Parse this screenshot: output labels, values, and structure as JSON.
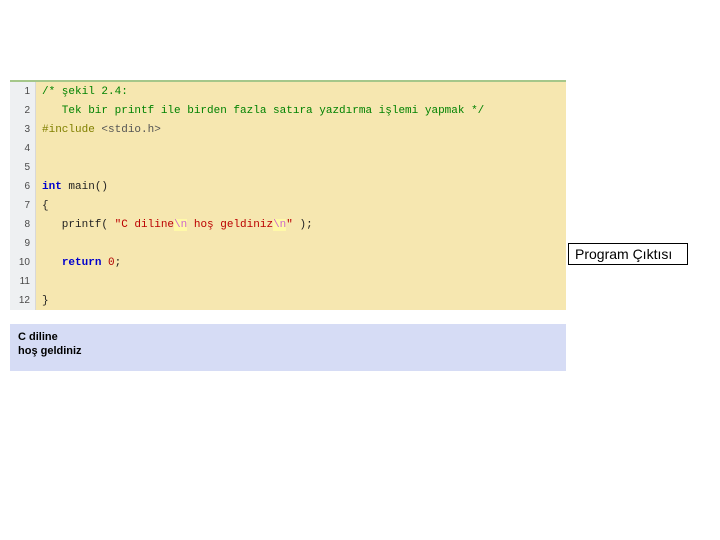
{
  "code": {
    "lines": [
      {
        "num": "1",
        "tokens": [
          {
            "cls": "tok-comment",
            "t": "/* şekil 2.4:"
          }
        ]
      },
      {
        "num": "2",
        "tokens": [
          {
            "cls": "tok-comment",
            "t": "   Tek bir printf ile birden fazla satıra yazdırma işlemi yapmak */"
          }
        ]
      },
      {
        "num": "3",
        "tokens": [
          {
            "cls": "tok-preproc",
            "t": "#include "
          },
          {
            "cls": "tok-preproc-arg",
            "t": "<stdio.h>"
          }
        ]
      },
      {
        "num": "4",
        "tokens": []
      },
      {
        "num": "5",
        "tokens": []
      },
      {
        "num": "6",
        "tokens": [
          {
            "cls": "tok-keyword",
            "t": "int"
          },
          {
            "cls": "tok-plain",
            "t": " main()"
          }
        ]
      },
      {
        "num": "7",
        "tokens": [
          {
            "cls": "tok-plain",
            "t": "{"
          }
        ]
      },
      {
        "num": "8",
        "tokens": [
          {
            "cls": "tok-plain",
            "t": "   printf( "
          },
          {
            "cls": "tok-string",
            "t": "\"C diline"
          },
          {
            "cls": "tok-escape",
            "t": "\\n"
          },
          {
            "cls": "tok-string",
            "t": " hoş geldiniz"
          },
          {
            "cls": "tok-escape",
            "t": "\\n"
          },
          {
            "cls": "tok-string",
            "t": "\""
          },
          {
            "cls": "tok-plain",
            "t": " );"
          }
        ]
      },
      {
        "num": "9",
        "tokens": []
      },
      {
        "num": "10",
        "tokens": [
          {
            "cls": "tok-plain",
            "t": "   "
          },
          {
            "cls": "tok-keyword",
            "t": "return"
          },
          {
            "cls": "tok-plain",
            "t": " "
          },
          {
            "cls": "tok-number",
            "t": "0"
          },
          {
            "cls": "tok-plain",
            "t": ";"
          }
        ]
      },
      {
        "num": "11",
        "tokens": []
      },
      {
        "num": "12",
        "tokens": [
          {
            "cls": "tok-plain",
            "t": "}"
          }
        ]
      }
    ]
  },
  "label": "Program Çıktısı",
  "output": {
    "line1": "C diline",
    "line2": "hoş geldiniz"
  }
}
